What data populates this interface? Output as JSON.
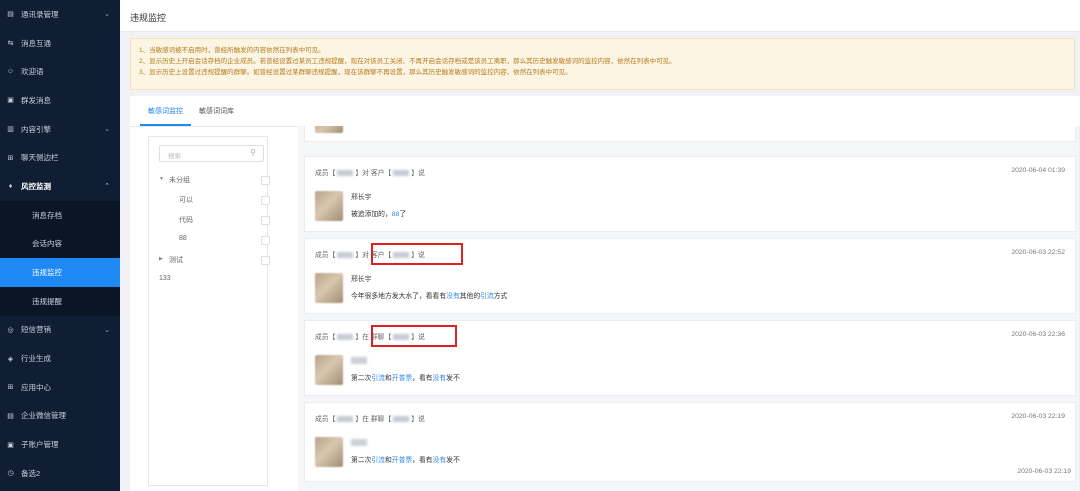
{
  "sidebar": {
    "items": [
      {
        "label": "通讯录管理",
        "icon": "contacts-icon",
        "glyph": "▤",
        "chevron": "⌄"
      },
      {
        "label": "消息互通",
        "icon": "message-sync-icon",
        "glyph": "⇆",
        "chevron": ""
      },
      {
        "label": "欢迎语",
        "icon": "welcome-icon",
        "glyph": "☺",
        "chevron": ""
      },
      {
        "label": "群发消息",
        "icon": "broadcast-icon",
        "glyph": "▣",
        "chevron": ""
      },
      {
        "label": "内容引擎",
        "icon": "content-engine-icon",
        "glyph": "▥",
        "chevron": "⌄"
      },
      {
        "label": "聊天侧边栏",
        "icon": "chat-sidebar-icon",
        "glyph": "⊞",
        "chevron": ""
      },
      {
        "label": "风控监测",
        "icon": "risk-monitor-icon",
        "glyph": "♦",
        "chevron": "⌃"
      }
    ],
    "sub_items": [
      "消息存档",
      "会话内容",
      "违规监控",
      "违规提醒"
    ],
    "items_after": [
      {
        "label": "短信营销",
        "icon": "sms-icon",
        "glyph": "◎",
        "chevron": "⌄"
      },
      {
        "label": "行业生成",
        "icon": "industry-icon",
        "glyph": "◈",
        "chevron": ""
      },
      {
        "label": "应用中心",
        "icon": "app-center-icon",
        "glyph": "⊞",
        "chevron": ""
      },
      {
        "label": "企业微信管理",
        "icon": "wecom-icon",
        "glyph": "▤",
        "chevron": ""
      },
      {
        "label": "子账户管理",
        "icon": "sub-account-icon",
        "glyph": "▣",
        "chevron": ""
      },
      {
        "label": "备选2",
        "icon": "backup-icon",
        "glyph": "◷",
        "chevron": ""
      }
    ]
  },
  "page": {
    "title": "违规监控"
  },
  "notice": {
    "lines": [
      "1、当敏感词被不启用时，曾经所触发的内容依然在列表中可见。",
      "2、显示历史上开启会话存档的企业成员。若曾经设置过某员工违规提醒，现在对该员工关闭、不再开启会话存档或是该员工离职，那么其历史触发敏感词的监控内容，依然在列表中可见。",
      "3、显示历史上设置过违规提醒的群聊。如曾经设置过某群聊违规提醒，现在该群聊不再设置，那么其历史触发敏感词的监控内容，依然在列表中可见。"
    ]
  },
  "tabs": [
    "敏感词监控",
    "敏感词词库"
  ],
  "tree": {
    "search_placeholder": "搜索",
    "nodes": [
      {
        "label": "未分组",
        "arrow": "▼",
        "level": 0
      },
      {
        "label": "可以",
        "arrow": "",
        "level": 1
      },
      {
        "label": "代码",
        "arrow": "",
        "level": 1
      },
      {
        "label": "88",
        "arrow": "",
        "level": 1
      },
      {
        "label": "测试",
        "arrow": "▶",
        "level": 0
      },
      {
        "label": "133",
        "arrow": "",
        "level": -1
      }
    ]
  },
  "messages": [
    {
      "head_a": "成员【",
      "head_b": "】对 客户【",
      "head_c": "】说",
      "time": "2020-06-04 01:39",
      "sender": "邢长宇",
      "text_parts": [
        {
          "t": "被追添加的，",
          "link": false
        },
        {
          "t": "88",
          "link": true
        },
        {
          "t": "了",
          "link": false
        }
      ]
    },
    {
      "head_a": "成员【",
      "head_b": "】对 客户【",
      "head_c": "】说",
      "time": "2020-06-03 22:52",
      "sender": "邢长宇",
      "text_parts": [
        {
          "t": "今年很多地方发大水了，看看有",
          "link": false
        },
        {
          "t": "没有",
          "link": true
        },
        {
          "t": "其他的",
          "link": false
        },
        {
          "t": "引流",
          "link": true
        },
        {
          "t": "方式",
          "link": false
        }
      ]
    },
    {
      "head_a": "成员【",
      "head_b": "】在 群聊【",
      "head_c": "】说",
      "time": "2020-06-03 22:36",
      "sender": "",
      "text_parts": [
        {
          "t": "第二次",
          "link": false
        },
        {
          "t": "引流",
          "link": true
        },
        {
          "t": "和",
          "link": false
        },
        {
          "t": "开普票",
          "link": true
        },
        {
          "t": "，看有",
          "link": false
        },
        {
          "t": "没有",
          "link": true
        },
        {
          "t": "发不",
          "link": false
        }
      ]
    },
    {
      "head_a": "成员【",
      "head_b": "】在 群聊【",
      "head_c": "】说",
      "time": "2020-06-03 22:19",
      "sender": "",
      "text_parts": [
        {
          "t": "第二次",
          "link": false
        },
        {
          "t": "引流",
          "link": true
        },
        {
          "t": "和",
          "link": false
        },
        {
          "t": "开普票",
          "link": true
        },
        {
          "t": "，看有",
          "link": false
        },
        {
          "t": "没有",
          "link": true
        },
        {
          "t": "发不",
          "link": false
        }
      ]
    }
  ],
  "partial_time": "2020-06-03 22:19"
}
